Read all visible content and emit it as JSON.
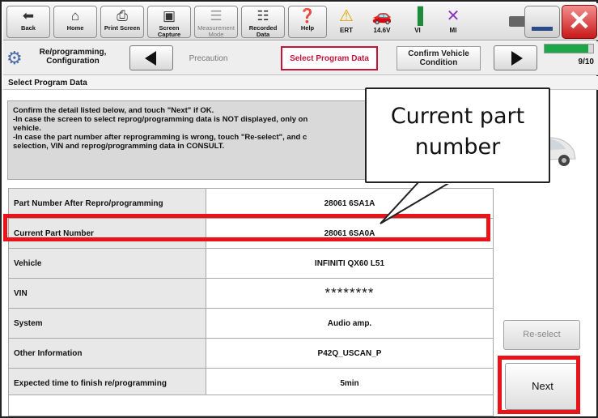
{
  "toolbar": {
    "back_label": "Back",
    "home_label": "Home",
    "print_screen_label": "Print Screen",
    "screen_capture_label": "Screen Capture",
    "measurement_mode_label": "Measurement Mode",
    "recorded_data_label": "Recorded Data",
    "help_label": "Help",
    "ert_label": "ERT",
    "voltage_label": "14.6V",
    "vi_label": "VI",
    "mi_label": "MI"
  },
  "stepbar": {
    "mode_label": "Re/programming, Configuration",
    "steps": [
      {
        "label": "Precaution"
      },
      {
        "label": "Select Program Data"
      },
      {
        "label": "Confirm Vehicle Condition"
      }
    ],
    "progress_fraction": 0.9,
    "counter": "9/10"
  },
  "page": {
    "title": "Select Program Data",
    "instructions": [
      "Confirm the detail listed below, and touch \"Next\" if OK.",
      "-In case the screen to select reprog/programming data is NOT displayed, only on",
      "vehicle.",
      "-In case the part number after reprogramming is wrong, touch \"Re-select\", and c",
      "selection, VIN and reprog/programming data in CONSULT."
    ]
  },
  "table": {
    "rows": [
      {
        "label": "Part Number After Repro/programming",
        "value": "28061 6SA1A"
      },
      {
        "label": "Current Part Number",
        "value": "28061 6SA0A"
      },
      {
        "label": "Vehicle",
        "value": "INFINITI QX60 L51"
      },
      {
        "label": "VIN",
        "value": "********"
      },
      {
        "label": "System",
        "value": "Audio amp."
      },
      {
        "label": "Other Information",
        "value": "P42Q_USCAN_P"
      },
      {
        "label": "Expected time to finish re/programming",
        "value": "5min"
      }
    ]
  },
  "buttons": {
    "reselect_label": "Re-select",
    "next_label": "Next"
  },
  "callout": {
    "line1": "Current part",
    "line2": "number",
    "highlight_color": "#e8141a"
  }
}
